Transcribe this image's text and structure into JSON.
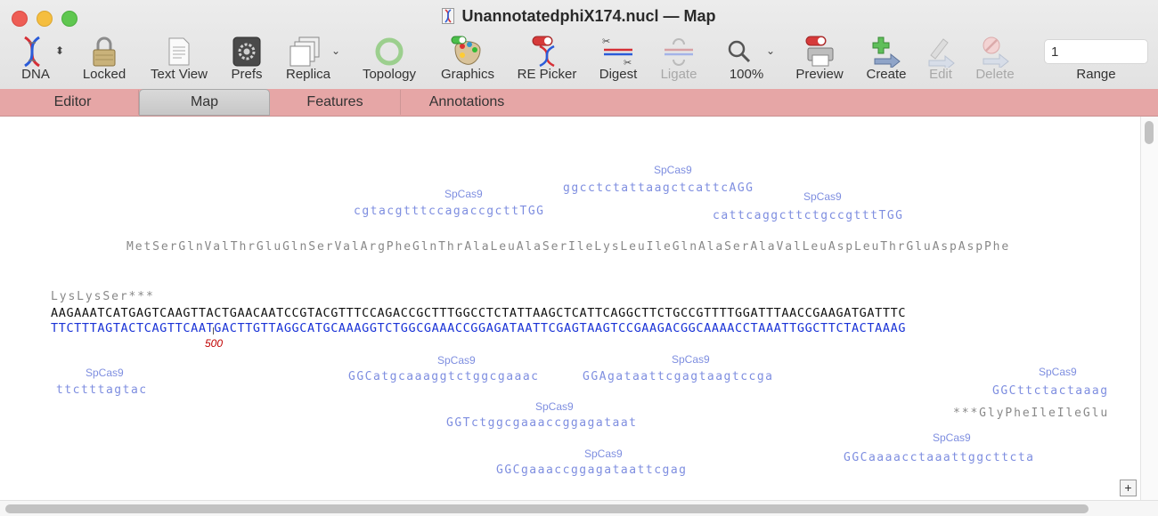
{
  "window": {
    "title": "UnannotatedphiX174.nucl — Map"
  },
  "toolbar": {
    "dna": "DNA",
    "locked": "Locked",
    "text_view": "Text View",
    "prefs": "Prefs",
    "replica": "Replica",
    "topology": "Topology",
    "graphics": "Graphics",
    "re_picker": "RE Picker",
    "digest": "Digest",
    "ligate": "Ligate",
    "zoom": "100%",
    "preview": "Preview",
    "create": "Create",
    "edit": "Edit",
    "delete": "Delete",
    "range_label": "Range",
    "range_value": "1"
  },
  "tabs": [
    {
      "label": "Editor"
    },
    {
      "label": "Map",
      "active": true
    },
    {
      "label": "Features"
    },
    {
      "label": "Annotations"
    }
  ],
  "map": {
    "guides_above": [
      {
        "label": "SpCas9",
        "seq": "ggcctctattaagctcattcAGG"
      },
      {
        "label": "SpCas9",
        "seq": "cgtacgtttccagaccgcttTGG"
      },
      {
        "label": "SpCas9",
        "seq": "cattcaggcttctgccgtttTGG"
      }
    ],
    "protein_top": "MetSerGlnValThrGluGlnSerValArgPheGlnThrAlaLeuAlaSerIleLysLeuIleGlnAlaSerAlaValLeuAspLeuThrGluAspAspPhe",
    "protein_prev": "LysLysSer***",
    "top_strand": "AAGAAATCATGAGTCAAGTTACTGAACAATCCGTACGTTTCCAGACCGCTTTGGCCTCTATTAAGCTCATTCAGGCTTCTGCCGTTTTGGATTTAACCGAAGATGATTTC",
    "bottom_strand": "TTCTTTAGTACTCAGTTCAATGACTTGTTAGGCATGCAAAGGTCTGGCGAAACCGGAGATAATTCGAGTAAGTCCGAAGACGGCAAAACCTAAATTGGCTTCTACTAAAG",
    "position_marker": "500",
    "guides_below": [
      {
        "label": "SpCas9",
        "seq": "ttctttagtac"
      },
      {
        "label": "SpCas9",
        "seq": "GGCatgcaaaggtctggcgaaac"
      },
      {
        "label": "SpCas9",
        "seq": "GGAgataattcgagtaagtccga"
      },
      {
        "label": "SpCas9",
        "seq": "GGCttctactaaag"
      },
      {
        "label": "SpCas9",
        "seq": "GGTctggcgaaaccggagataat"
      },
      {
        "label": "SpCas9",
        "seq": "GGCgaaaccggagataattcgag"
      },
      {
        "label": "SpCas9",
        "seq": "GGCaaaacctaaattggcttcta"
      }
    ],
    "protein_bottom": "***GlyPheIleIleGlu"
  },
  "colors": {
    "tab_bar": "#e6a6a6",
    "guide": "#7e8ee0",
    "bottom_strand": "#1a33d6",
    "marker": "#c00000"
  }
}
